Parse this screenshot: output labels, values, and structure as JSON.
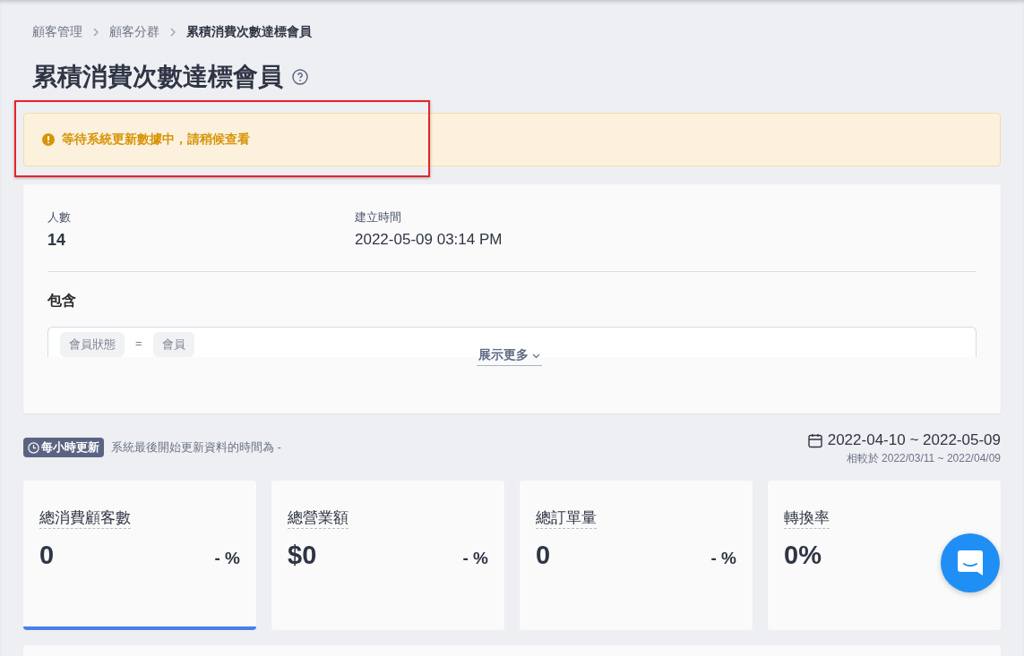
{
  "breadcrumb": [
    {
      "label": "顧客管理",
      "current": false
    },
    {
      "label": "顧客分群",
      "current": false
    },
    {
      "label": "累積消費次數達標會員",
      "current": true
    }
  ],
  "title": "累積消費次數達標會員",
  "alert": {
    "text": "等待系統更新數據中，請稍候查看",
    "highlighted": true
  },
  "summary": {
    "fields": [
      {
        "label": "人數",
        "value": "14",
        "kind": "bold"
      },
      {
        "label": "建立時間",
        "value": "2022-05-09 03:14 PM",
        "kind": "plain"
      }
    ],
    "include_title": "包含",
    "conditions": [
      {
        "text": "會員狀態",
        "kind": "chip"
      },
      {
        "text": "=",
        "kind": "operator"
      },
      {
        "text": "會員",
        "kind": "chip"
      }
    ],
    "show_more": "展示更多"
  },
  "update": {
    "badge": "每小時更新",
    "note": "系統最後開始更新資料的時間為 -",
    "date_range": "2022-04-10 ~ 2022-05-09",
    "compare": "相較於 2022/03/11 ~ 2022/04/09"
  },
  "metrics": [
    {
      "label": "總消費顧客數",
      "value": "0",
      "change": "- %",
      "selected": true
    },
    {
      "label": "總營業額",
      "value": "$0",
      "change": "- %",
      "selected": false
    },
    {
      "label": "總訂單量",
      "value": "0",
      "change": "- %",
      "selected": false
    },
    {
      "label": "轉換率",
      "value": "0%",
      "selected": false
    }
  ]
}
